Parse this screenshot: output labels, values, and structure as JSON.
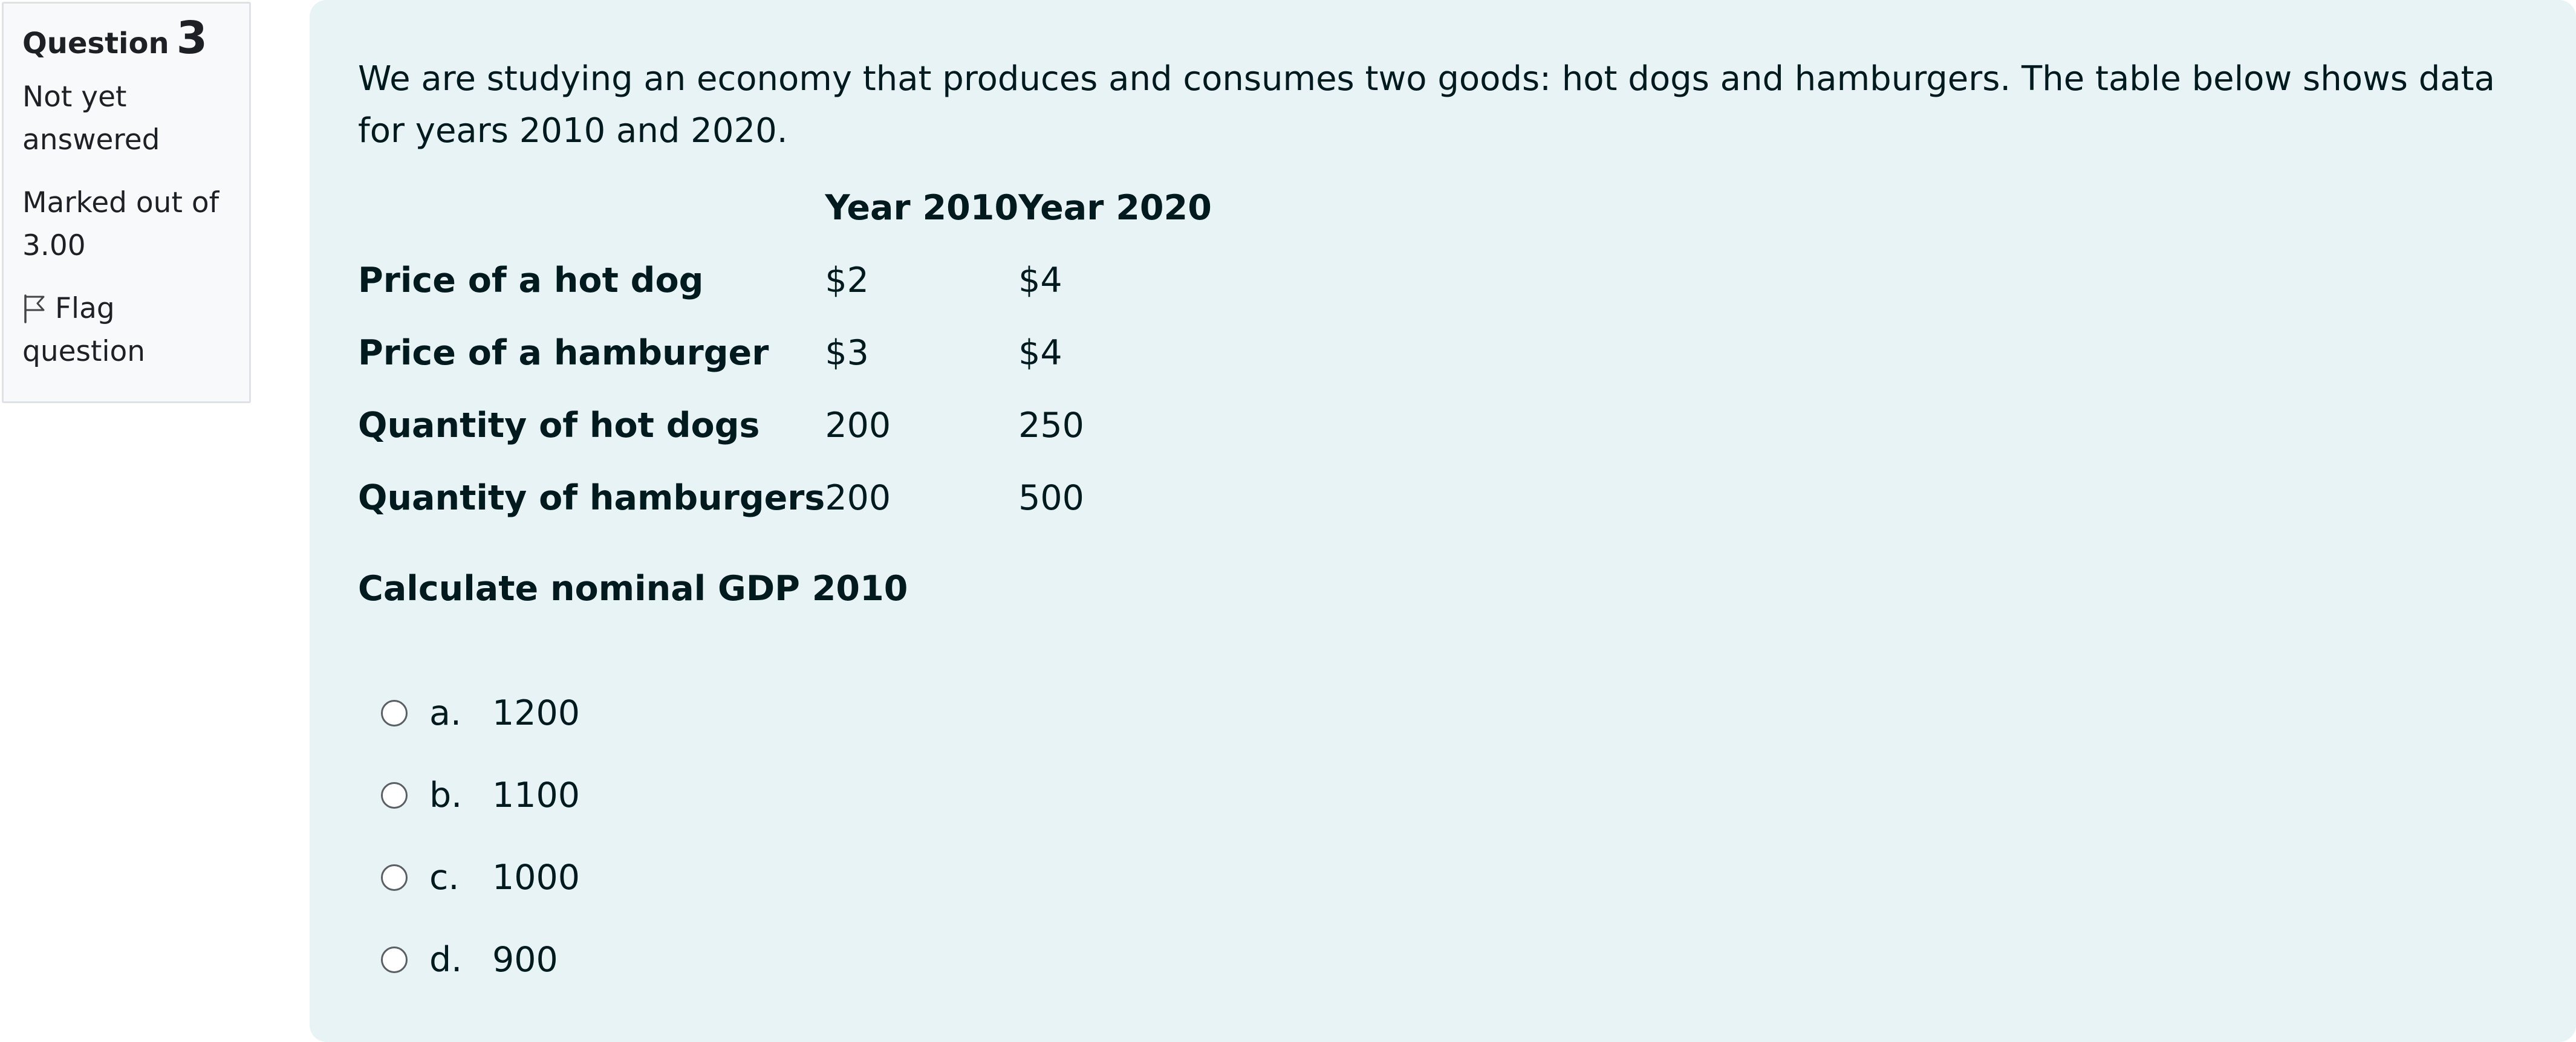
{
  "info": {
    "question_label": "Question",
    "question_number": "3",
    "state": "Not yet answered",
    "grade": "Marked out of 3.00",
    "flag_label": "Flag question",
    "flag_icon": "flag-icon"
  },
  "question": {
    "text": "We are studying an economy that produces and consumes two goods: hot dogs and hamburgers. The table below shows data for years 2010 and 2020.",
    "table": {
      "headers": [
        "",
        "Year 2010",
        "Year 2020"
      ],
      "rows": [
        [
          "Price of a hot dog",
          "$2",
          "$4"
        ],
        [
          "Price of a hamburger",
          "$3",
          "$4"
        ],
        [
          "Quantity of hot dogs",
          "200",
          "250"
        ],
        [
          "Quantity of hamburgers",
          "200",
          "500"
        ]
      ]
    },
    "prompt": "Calculate nominal GDP 2010",
    "options": [
      {
        "letter": "a.",
        "value": "1200"
      },
      {
        "letter": "b.",
        "value": "1100"
      },
      {
        "letter": "c.",
        "value": "1000"
      },
      {
        "letter": "d.",
        "value": "900"
      }
    ]
  }
}
